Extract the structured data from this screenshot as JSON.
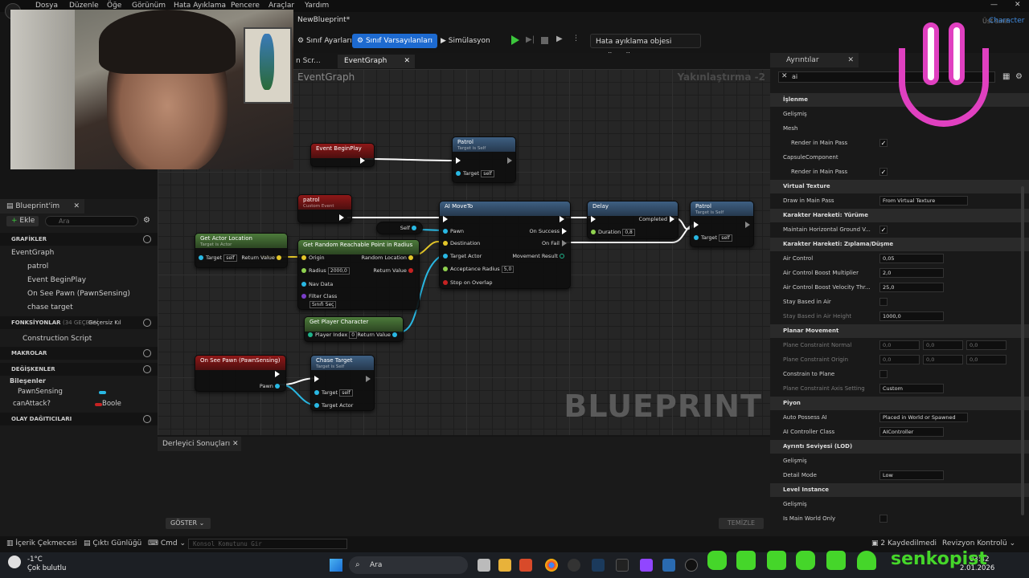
{
  "menu": [
    "Dosya",
    "Düzenle",
    "Öğe",
    "Görünüm",
    "Hata Ayıklama",
    "Pencere",
    "Araçlar",
    "Yardım"
  ],
  "window": {
    "tab_title": "NewBlueprint*",
    "parent_class_label": "Üst sınıf:",
    "parent_class": "Character"
  },
  "toolbar": {
    "class_settings": "Sınıf Ayarları",
    "class_defaults": "Sınıf Varsayılanları",
    "simulation": "Simülasyon",
    "debug_object": "Hata ayıklama objesi seçilmedi"
  },
  "graph_tabs": {
    "tab1": "n Scr...",
    "tab2": "EventGraph"
  },
  "graph": {
    "title": "EventGraph",
    "zoom": "Yakınlaştırma -2",
    "watermark": "BLUEPRINT"
  },
  "nodes": {
    "event_begin_play": {
      "title": "Event BeginPlay"
    },
    "patrol_top": {
      "title": "Patrol",
      "sub": "Target is Self",
      "target": "Target",
      "self": "self"
    },
    "patrol_event": {
      "title": "patrol",
      "sub": "Custom Event"
    },
    "self_node": {
      "title": "Self"
    },
    "ai_move_to": {
      "title": "AI MoveTo",
      "pawn": "Pawn",
      "destination": "Destination",
      "target_actor": "Target Actor",
      "acceptance_radius": "Acceptance Radius",
      "acceptance_value": "5,0",
      "stop_on_overlap": "Stop on Overlap",
      "on_success": "On Success",
      "on_fail": "On Fail",
      "movement_result": "Movement Result"
    },
    "delay": {
      "title": "Delay",
      "duration": "Duration",
      "duration_value": "0,8",
      "completed": "Completed"
    },
    "patrol_right": {
      "title": "Patrol",
      "sub": "Target is Self",
      "target": "Target",
      "self": "self"
    },
    "get_actor_location": {
      "title": "Get Actor Location",
      "sub": "Target is Actor",
      "target": "Target",
      "self": "self",
      "return": "Return Value"
    },
    "get_random_point": {
      "title": "Get Random Reachable Point in Radius",
      "origin": "Origin",
      "radius": "Radius",
      "radius_value": "2000,0",
      "nav_data": "Nav Data",
      "filter_class": "Filter Class",
      "select": "Sınıfı Seç",
      "random_location": "Random Location",
      "return": "Return Value"
    },
    "get_player_character": {
      "title": "Get Player Character",
      "player_index": "Player Index",
      "index_value": "0",
      "return": "Return Value"
    },
    "on_see_pawn": {
      "title": "On See Pawn (PawnSensing)",
      "pawn": "Pawn"
    },
    "chase_target": {
      "title": "Chase Target",
      "sub": "Target is Self",
      "target": "Target",
      "self": "self",
      "target_actor": "Target Actor"
    }
  },
  "left_panel": {
    "tab": "Blueprint'im",
    "add": "Ekle",
    "search_placeholder": "Ara",
    "sections": {
      "graphs": "GRAFİKLER",
      "functions": "FONKSİYONLAR",
      "functions_count": "(34 GEÇERSİ",
      "override": "Geçersiz Kıl",
      "macros": "MAKROLAR",
      "variables": "DEĞİŞKENLER",
      "dispatchers": "OLAY DAĞITICILARI"
    },
    "graph_items": [
      "EventGraph",
      "patrol",
      "Event BeginPlay",
      "On See Pawn (PawnSensing)",
      "chase target"
    ],
    "construction": "Construction Script",
    "components": "Bileşenler",
    "pawn_sensing": "PawnSensing",
    "can_attack": "canAttack?",
    "bool": "Boole"
  },
  "compiler": {
    "tab": "Derleyici Sonuçları",
    "show": "GÖSTER",
    "clear": "TEMİZLE"
  },
  "details": {
    "tab": "Ayrıntılar",
    "search": "ai",
    "rows": [
      {
        "type": "sec",
        "label": "İşlenme"
      },
      {
        "type": "row",
        "label": "Gelişmiş"
      },
      {
        "type": "row",
        "label": "Mesh"
      },
      {
        "type": "row",
        "label": "Render in Main Pass",
        "indent": true,
        "check": true
      },
      {
        "type": "row",
        "label": "CapsuleComponent"
      },
      {
        "type": "row",
        "label": "Render in Main Pass",
        "indent": true,
        "check": true
      },
      {
        "type": "sec",
        "label": "Virtual Texture"
      },
      {
        "type": "row",
        "label": "Draw in Main Pass",
        "value": "From Virtual Texture"
      },
      {
        "type": "sec",
        "label": "Karakter Hareketi: Yürüme"
      },
      {
        "type": "row",
        "label": "Maintain Horizontal Ground V...",
        "check": true
      },
      {
        "type": "sec",
        "label": "Karakter Hareketi: Zıplama/Düşme"
      },
      {
        "type": "row",
        "label": "Air Control",
        "value": "0,05"
      },
      {
        "type": "row",
        "label": "Air Control Boost Multiplier",
        "value": "2,0"
      },
      {
        "type": "row",
        "label": "Air Control Boost Velocity Thr...",
        "value": "25,0"
      },
      {
        "type": "row",
        "label": "Stay Based in Air",
        "check": false
      },
      {
        "type": "row",
        "label": "Stay Based in Air Height",
        "value": "1000,0",
        "dim": true
      },
      {
        "type": "sec",
        "label": "Planar Movement"
      },
      {
        "type": "row",
        "label": "Plane Constraint Normal",
        "triple": [
          "0,0",
          "0,0",
          "0,0"
        ],
        "dim": true
      },
      {
        "type": "row",
        "label": "Plane Constraint Origin",
        "triple": [
          "0,0",
          "0,0",
          "0,0"
        ],
        "dim": true
      },
      {
        "type": "row",
        "label": "Constrain to Plane",
        "check": false
      },
      {
        "type": "row",
        "label": "Plane Constraint Axis Setting",
        "value": "Custom",
        "dim": true
      },
      {
        "type": "sec",
        "label": "Piyon"
      },
      {
        "type": "row",
        "label": "Auto Possess AI",
        "value": "Placed in World or Spawned"
      },
      {
        "type": "row",
        "label": "AI Controller Class",
        "value": "AIController"
      },
      {
        "type": "sec",
        "label": "Ayrıntı Seviyesi (LOD)"
      },
      {
        "type": "row",
        "label": "Gelişmiş"
      },
      {
        "type": "row",
        "label": "Detail Mode",
        "value": "Low"
      },
      {
        "type": "sec",
        "label": "Level Instance"
      },
      {
        "type": "row",
        "label": "Gelişmiş"
      },
      {
        "type": "row",
        "label": "Is Main World Only",
        "check": false
      }
    ]
  },
  "statusbar": {
    "content_drawer": "İçerik Çekmecesi",
    "output_log": "Çıktı Günlüğü",
    "cmd": "Cmd",
    "console_placeholder": "Konsol Komutunu Gir",
    "saved": "2 Kaydedilmedi",
    "revision": "Revizyon Kontrolü"
  },
  "taskbar": {
    "temp": "-1°C",
    "weather": "Çok bulutlu",
    "search": "Ara",
    "time": "03:42",
    "date": "2.01.2026",
    "brand": "senkopist"
  }
}
